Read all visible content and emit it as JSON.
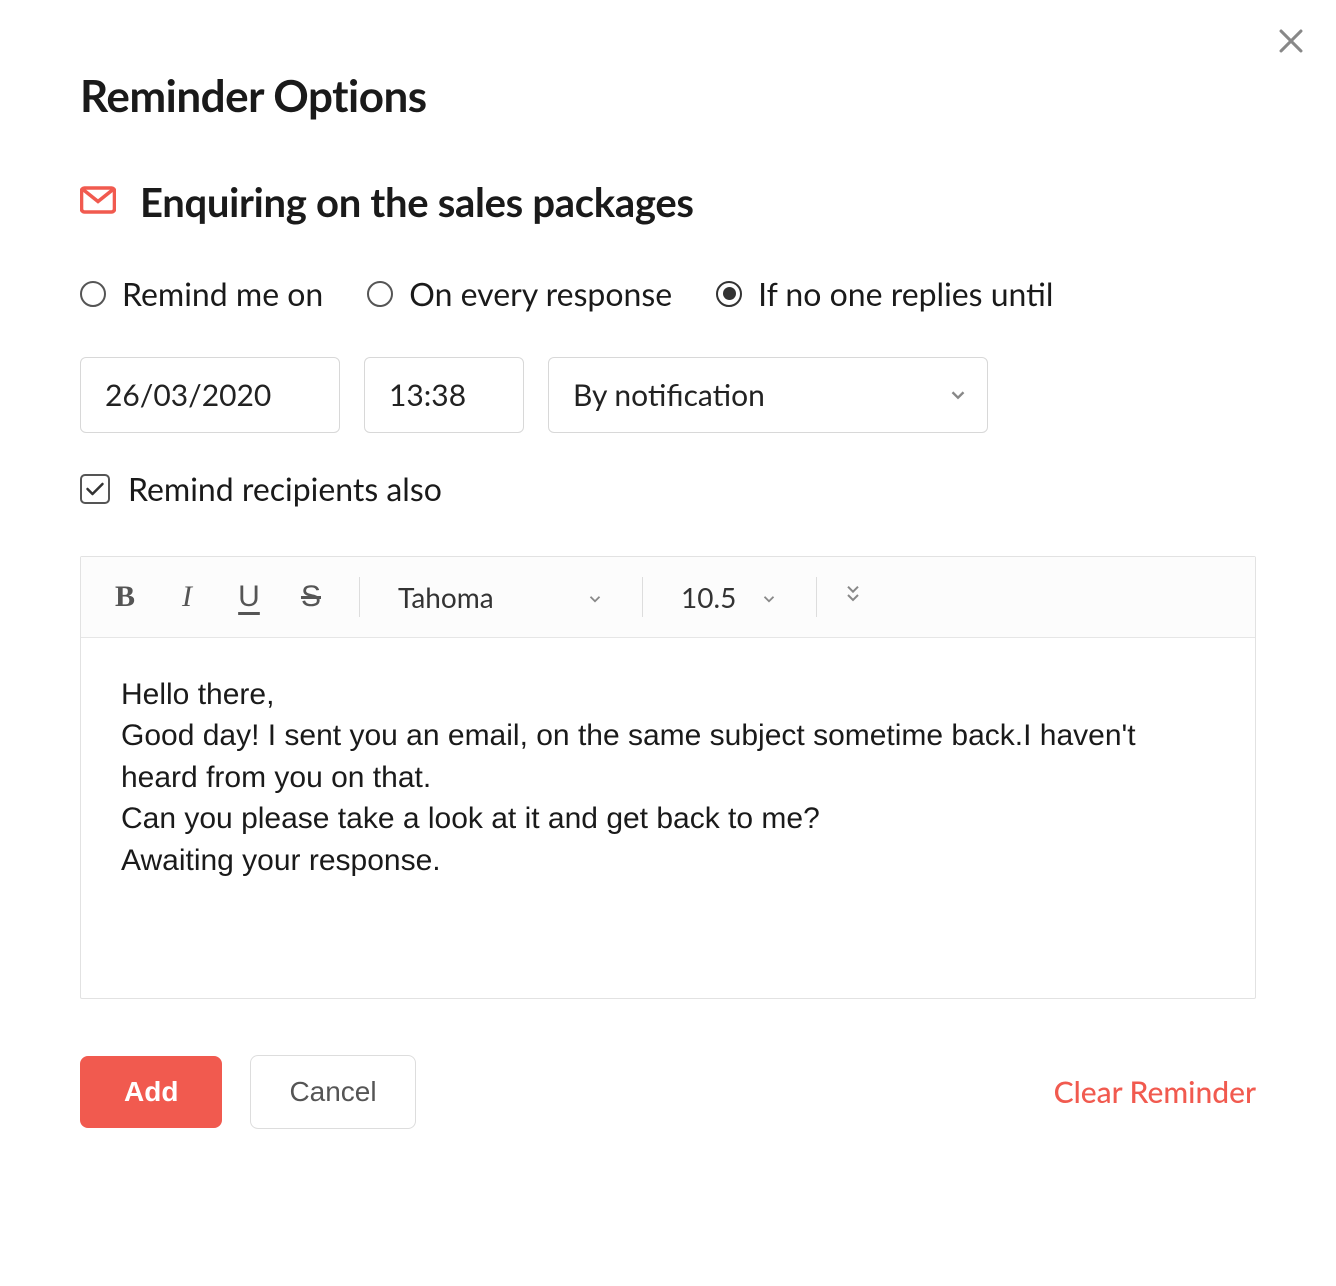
{
  "title": "Reminder Options",
  "subject": "Enquiring on the sales packages",
  "radios": {
    "remind_on_label": "Remind me on",
    "every_response_label": "On every response",
    "no_reply_until_label": "If no one replies until",
    "selected": "no_reply_until"
  },
  "date_value": "26/03/2020",
  "time_value": "13:38",
  "method": {
    "selected": "By notification"
  },
  "remind_recipients": {
    "label": "Remind recipients also",
    "checked": true
  },
  "editor": {
    "font": "Tahoma",
    "size": "10.5",
    "body_line1": "Hello there,",
    "body_line2": "Good day! I sent you an email, on the same subject sometime back.I haven't heard from you on that.",
    "body_line3": "Can you please take a look at it and get back to me?",
    "body_line4": "Awaiting your response."
  },
  "buttons": {
    "add": "Add",
    "cancel": "Cancel",
    "clear": "Clear Reminder"
  },
  "icons": {
    "bold": "B",
    "italic": "I",
    "underline": "U",
    "strike": "S"
  }
}
